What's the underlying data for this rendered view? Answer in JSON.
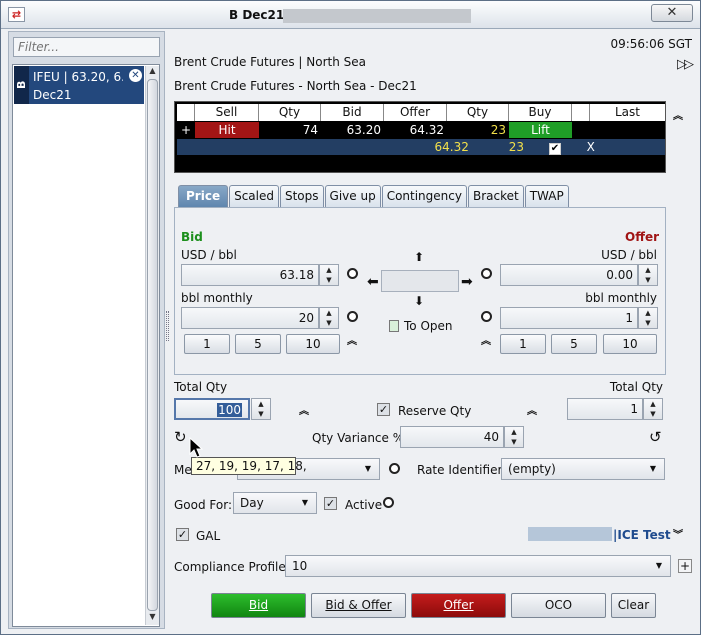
{
  "window": {
    "title": "B Dec21",
    "close_label": "✕"
  },
  "left": {
    "filter_placeholder": "Filter...",
    "list_badge": "B",
    "list_line1": "IFEU | 63.20, 6...",
    "list_line2": "Dec21"
  },
  "header": {
    "time": "09:56:06 SGT",
    "instrument": "Brent Crude Futures | North Sea",
    "contract": "Brent Crude Futures - North Sea - Dec21"
  },
  "grid": {
    "columns": [
      "Sell",
      "Qty",
      "Bid",
      "Offer",
      "Qty",
      "Buy",
      "",
      "Last"
    ],
    "row1": {
      "expand": "+",
      "sell": "Hit",
      "qty": "74",
      "bid": "63.20",
      "offer": "64.32",
      "qty2": "23",
      "buy": "Lift"
    },
    "row2": {
      "offer": "64.32",
      "qty2": "23",
      "check": "✔",
      "mark": "X"
    }
  },
  "tabs": [
    "Price",
    "Scaled",
    "Stops",
    "Give up",
    "Contingency",
    "Bracket",
    "TWAP"
  ],
  "price": {
    "bid_label": "Bid",
    "offer_label": "Offer",
    "unit": "USD / bbl",
    "bid_price": "63.18",
    "offer_price": "0.00",
    "qty_unit": "bbl monthly",
    "bid_qty": "20",
    "offer_qty": "1",
    "steps": [
      "1",
      "5",
      "10"
    ],
    "to_open": "To Open"
  },
  "order": {
    "total_qty_label": "Total Qty",
    "total_qty_left": "100",
    "total_qty_right": "1",
    "reserve_qty": "Reserve Qty",
    "qty_variance_label": "Qty Variance %",
    "qty_variance": "40",
    "method_label": "Me",
    "tooltip": "27, 19, 19, 17, 18,",
    "rate_identifier_label": "Rate Identifier:",
    "rate_identifier": "(empty)",
    "good_for_label": "Good For:",
    "good_for": "Day",
    "active_label": "Active",
    "gal_label": "GAL",
    "account": "|ICE Test",
    "compliance_label": "Compliance Profile",
    "compliance_value": "10"
  },
  "actions": {
    "bid": "Bid",
    "bid_offer": "Bid & Offer",
    "offer": "Offer",
    "oco": "OCO",
    "clear": "Clear"
  },
  "colors": {
    "bid_green": "#1c8f1c",
    "offer_red": "#a01414",
    "hit_red": "#a31515",
    "lift_green": "#1f9e27",
    "tab_active": "#6f94b9"
  }
}
